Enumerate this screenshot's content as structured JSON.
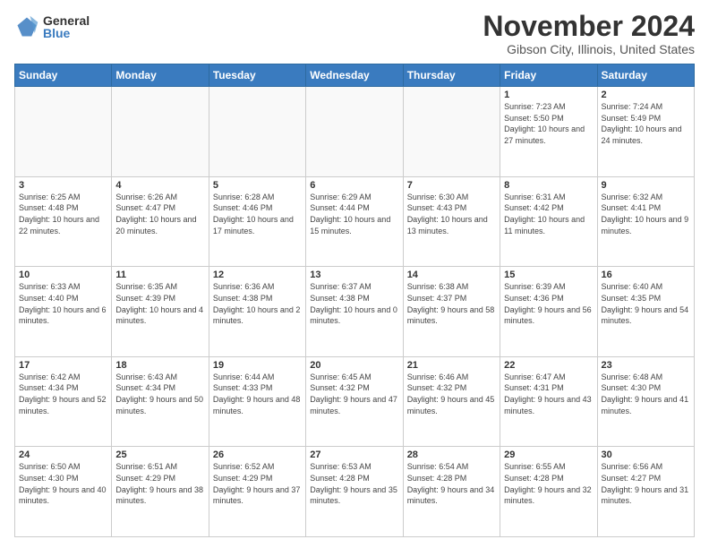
{
  "header": {
    "logo": {
      "general": "General",
      "blue": "Blue"
    },
    "title": "November 2024",
    "subtitle": "Gibson City, Illinois, United States"
  },
  "weekdays": [
    "Sunday",
    "Monday",
    "Tuesday",
    "Wednesday",
    "Thursday",
    "Friday",
    "Saturday"
  ],
  "weeks": [
    [
      {
        "day": "",
        "info": ""
      },
      {
        "day": "",
        "info": ""
      },
      {
        "day": "",
        "info": ""
      },
      {
        "day": "",
        "info": ""
      },
      {
        "day": "",
        "info": ""
      },
      {
        "day": "1",
        "info": "Sunrise: 7:23 AM\nSunset: 5:50 PM\nDaylight: 10 hours and 27 minutes."
      },
      {
        "day": "2",
        "info": "Sunrise: 7:24 AM\nSunset: 5:49 PM\nDaylight: 10 hours and 24 minutes."
      }
    ],
    [
      {
        "day": "3",
        "info": "Sunrise: 6:25 AM\nSunset: 4:48 PM\nDaylight: 10 hours and 22 minutes."
      },
      {
        "day": "4",
        "info": "Sunrise: 6:26 AM\nSunset: 4:47 PM\nDaylight: 10 hours and 20 minutes."
      },
      {
        "day": "5",
        "info": "Sunrise: 6:28 AM\nSunset: 4:46 PM\nDaylight: 10 hours and 17 minutes."
      },
      {
        "day": "6",
        "info": "Sunrise: 6:29 AM\nSunset: 4:44 PM\nDaylight: 10 hours and 15 minutes."
      },
      {
        "day": "7",
        "info": "Sunrise: 6:30 AM\nSunset: 4:43 PM\nDaylight: 10 hours and 13 minutes."
      },
      {
        "day": "8",
        "info": "Sunrise: 6:31 AM\nSunset: 4:42 PM\nDaylight: 10 hours and 11 minutes."
      },
      {
        "day": "9",
        "info": "Sunrise: 6:32 AM\nSunset: 4:41 PM\nDaylight: 10 hours and 9 minutes."
      }
    ],
    [
      {
        "day": "10",
        "info": "Sunrise: 6:33 AM\nSunset: 4:40 PM\nDaylight: 10 hours and 6 minutes."
      },
      {
        "day": "11",
        "info": "Sunrise: 6:35 AM\nSunset: 4:39 PM\nDaylight: 10 hours and 4 minutes."
      },
      {
        "day": "12",
        "info": "Sunrise: 6:36 AM\nSunset: 4:38 PM\nDaylight: 10 hours and 2 minutes."
      },
      {
        "day": "13",
        "info": "Sunrise: 6:37 AM\nSunset: 4:38 PM\nDaylight: 10 hours and 0 minutes."
      },
      {
        "day": "14",
        "info": "Sunrise: 6:38 AM\nSunset: 4:37 PM\nDaylight: 9 hours and 58 minutes."
      },
      {
        "day": "15",
        "info": "Sunrise: 6:39 AM\nSunset: 4:36 PM\nDaylight: 9 hours and 56 minutes."
      },
      {
        "day": "16",
        "info": "Sunrise: 6:40 AM\nSunset: 4:35 PM\nDaylight: 9 hours and 54 minutes."
      }
    ],
    [
      {
        "day": "17",
        "info": "Sunrise: 6:42 AM\nSunset: 4:34 PM\nDaylight: 9 hours and 52 minutes."
      },
      {
        "day": "18",
        "info": "Sunrise: 6:43 AM\nSunset: 4:34 PM\nDaylight: 9 hours and 50 minutes."
      },
      {
        "day": "19",
        "info": "Sunrise: 6:44 AM\nSunset: 4:33 PM\nDaylight: 9 hours and 48 minutes."
      },
      {
        "day": "20",
        "info": "Sunrise: 6:45 AM\nSunset: 4:32 PM\nDaylight: 9 hours and 47 minutes."
      },
      {
        "day": "21",
        "info": "Sunrise: 6:46 AM\nSunset: 4:32 PM\nDaylight: 9 hours and 45 minutes."
      },
      {
        "day": "22",
        "info": "Sunrise: 6:47 AM\nSunset: 4:31 PM\nDaylight: 9 hours and 43 minutes."
      },
      {
        "day": "23",
        "info": "Sunrise: 6:48 AM\nSunset: 4:30 PM\nDaylight: 9 hours and 41 minutes."
      }
    ],
    [
      {
        "day": "24",
        "info": "Sunrise: 6:50 AM\nSunset: 4:30 PM\nDaylight: 9 hours and 40 minutes."
      },
      {
        "day": "25",
        "info": "Sunrise: 6:51 AM\nSunset: 4:29 PM\nDaylight: 9 hours and 38 minutes."
      },
      {
        "day": "26",
        "info": "Sunrise: 6:52 AM\nSunset: 4:29 PM\nDaylight: 9 hours and 37 minutes."
      },
      {
        "day": "27",
        "info": "Sunrise: 6:53 AM\nSunset: 4:28 PM\nDaylight: 9 hours and 35 minutes."
      },
      {
        "day": "28",
        "info": "Sunrise: 6:54 AM\nSunset: 4:28 PM\nDaylight: 9 hours and 34 minutes."
      },
      {
        "day": "29",
        "info": "Sunrise: 6:55 AM\nSunset: 4:28 PM\nDaylight: 9 hours and 32 minutes."
      },
      {
        "day": "30",
        "info": "Sunrise: 6:56 AM\nSunset: 4:27 PM\nDaylight: 9 hours and 31 minutes."
      }
    ]
  ]
}
